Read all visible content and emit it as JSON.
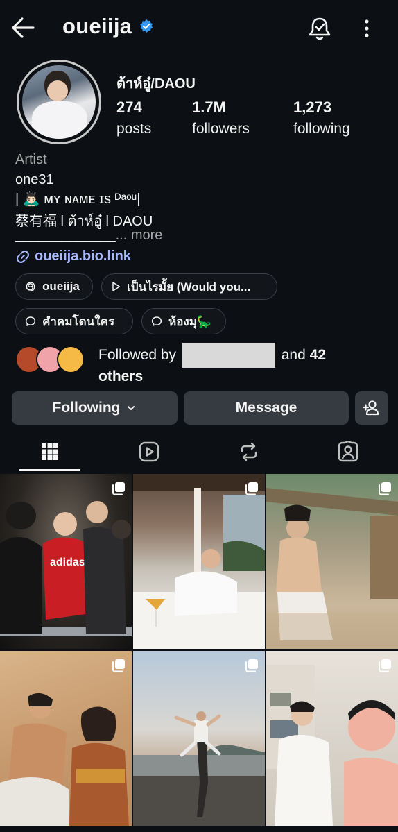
{
  "header": {
    "username": "oueiija"
  },
  "profile": {
    "display_name": "ต้าห์อู๋/DAOU",
    "stats": [
      {
        "value": "274",
        "label": "posts"
      },
      {
        "value": "1.7M",
        "label": "followers"
      },
      {
        "value": "1,273",
        "label": "following"
      }
    ],
    "category": "Artist",
    "bio": {
      "line1": "one31",
      "line2": "| 🙇🏻‍♂️ ᴍʏ ɴᴀᴍᴇ ɪs ᴰᵃᵒᵘ|",
      "line3": "    蔡有福 l ต้าห์อู๋ l DAOU",
      "line4": "_____________",
      "more": "... more"
    },
    "link": "oueiija.bio.link"
  },
  "chips": [
    {
      "label": "oueiija",
      "icon": "threads-icon"
    },
    {
      "label": "เป็นไรมั้ย (Would you...",
      "icon": "play-icon"
    },
    {
      "label": "คำคมโดนใคร",
      "icon": "highlight-icon"
    },
    {
      "label": "ห้องมุ🦕",
      "icon": "highlight-icon"
    }
  ],
  "followed_by": {
    "prefix": "Followed by",
    "middle": "and",
    "count": "42",
    "suffix": "others"
  },
  "actions": {
    "following": "Following",
    "message": "Message"
  },
  "tabs": [
    "grid-icon",
    "reels-icon",
    "reposts-icon",
    "tagged-icon"
  ],
  "colors": {
    "background": "#0c1014",
    "button": "#363a41",
    "link": "#a8b8ff",
    "verified": "#3897f0",
    "muted": "#a8a8a8"
  }
}
